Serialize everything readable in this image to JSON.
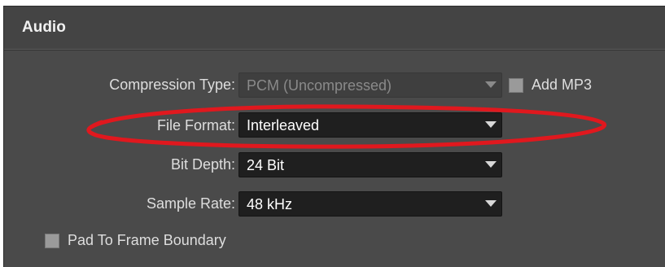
{
  "panel": {
    "title": "Audio"
  },
  "fields": {
    "compression_type": {
      "label": "Compression Type:",
      "value": "PCM (Uncompressed)"
    },
    "add_mp3": {
      "label": "Add MP3",
      "checked": false
    },
    "file_format": {
      "label": "File Format:",
      "value": "Interleaved"
    },
    "bit_depth": {
      "label": "Bit Depth:",
      "value": "24 Bit"
    },
    "sample_rate": {
      "label": "Sample Rate:",
      "value": "48 kHz"
    },
    "pad_to_frame": {
      "label": "Pad To Frame Boundary",
      "checked": false
    }
  },
  "icons": {
    "dropdown": "chevron-down-icon"
  },
  "colors": {
    "panel_bg": "#4a4a4a",
    "field_bg": "#1f1f1f",
    "annotation": "#e0181e"
  }
}
